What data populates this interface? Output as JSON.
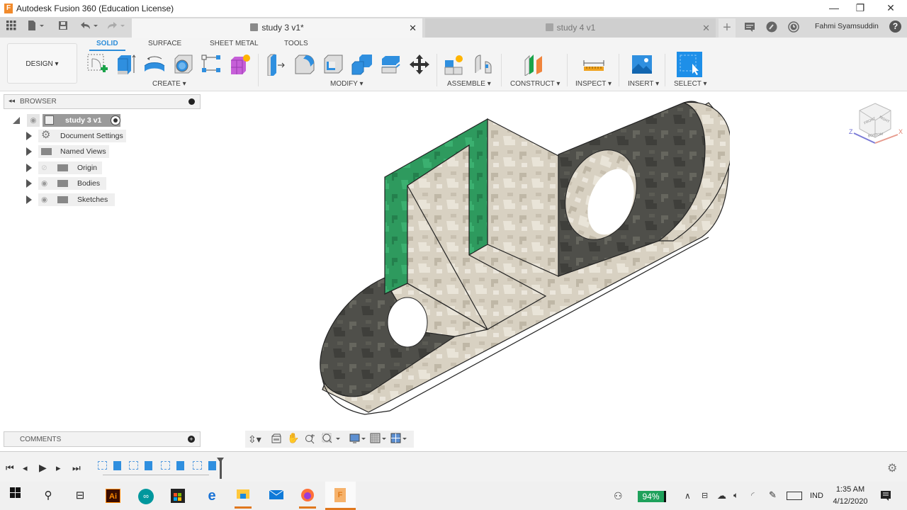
{
  "window": {
    "title": "Autodesk Fusion 360 (Education License)",
    "app_logo": "F",
    "minimize": "—",
    "restore": "❐",
    "close": "✕"
  },
  "tabs": [
    {
      "label": "study 3 v1*",
      "active": true,
      "close": "✕"
    },
    {
      "label": "study 4 v1",
      "active": false,
      "close": "✕"
    }
  ],
  "quickaccess": {
    "grid": "data-panel-icon",
    "file": "file-icon",
    "save": "save-icon",
    "undo": "undo-icon",
    "redo": "redo-icon",
    "new_tab": "+"
  },
  "header_right": {
    "user": "Fahmi Syamsuddin",
    "help": "?"
  },
  "toolbar": {
    "workspace": "DESIGN ▾",
    "ribbon_tabs": [
      "SOLID",
      "SURFACE",
      "SHEET METAL",
      "TOOLS"
    ],
    "active_tab": "SOLID",
    "groups": [
      {
        "label": "CREATE ▾",
        "tools": [
          "create-sketch",
          "extrude",
          "revolve",
          "hole",
          "pattern",
          "create-form"
        ]
      },
      {
        "label": "MODIFY ▾",
        "tools": [
          "press-pull",
          "fillet",
          "shell",
          "combine",
          "split-body",
          "move"
        ]
      },
      {
        "label": "ASSEMBLE ▾",
        "tools": [
          "new-component",
          "joint"
        ]
      },
      {
        "label": "CONSTRUCT ▾",
        "tools": [
          "offset-plane"
        ]
      },
      {
        "label": "INSPECT ▾",
        "tools": [
          "measure"
        ]
      },
      {
        "label": "INSERT ▾",
        "tools": [
          "insert-image"
        ]
      },
      {
        "label": "SELECT ▾",
        "tools": [
          "select"
        ]
      }
    ]
  },
  "browser": {
    "title": "BROWSER",
    "root": "study 3 v1",
    "items": [
      {
        "label": "Document Settings",
        "icon": "gear"
      },
      {
        "label": "Named Views",
        "icon": "folder"
      },
      {
        "label": "Origin",
        "icon": "folder",
        "hidden": true
      },
      {
        "label": "Bodies",
        "icon": "folder"
      },
      {
        "label": "Sketches",
        "icon": "folder"
      }
    ]
  },
  "viewcube": {
    "front": "FRONT",
    "right": "RIGHT",
    "bottom": "BOTTOM",
    "axis_z": "Z",
    "axis_x": "X"
  },
  "comments": {
    "title": "COMMENTS"
  },
  "navbar": [
    "orbit",
    "look-at",
    "pan",
    "zoom",
    "fit",
    "display-settings",
    "grid-settings",
    "viewports"
  ],
  "timeline": {
    "controls": [
      "first",
      "previous",
      "play",
      "next",
      "last"
    ],
    "features": [
      "sketch",
      "extrude",
      "sketch",
      "extrude",
      "sketch",
      "extrude",
      "sketch",
      "extrude"
    ]
  },
  "taskbar": {
    "apps": [
      "windows-start",
      "search",
      "task-view",
      "illustrator",
      "arduino",
      "store",
      "edge",
      "file-explorer",
      "mail",
      "firefox",
      "fusion360"
    ],
    "battery": "94%",
    "language": "IND",
    "time": "1:35 AM",
    "date": "4/12/2020"
  }
}
